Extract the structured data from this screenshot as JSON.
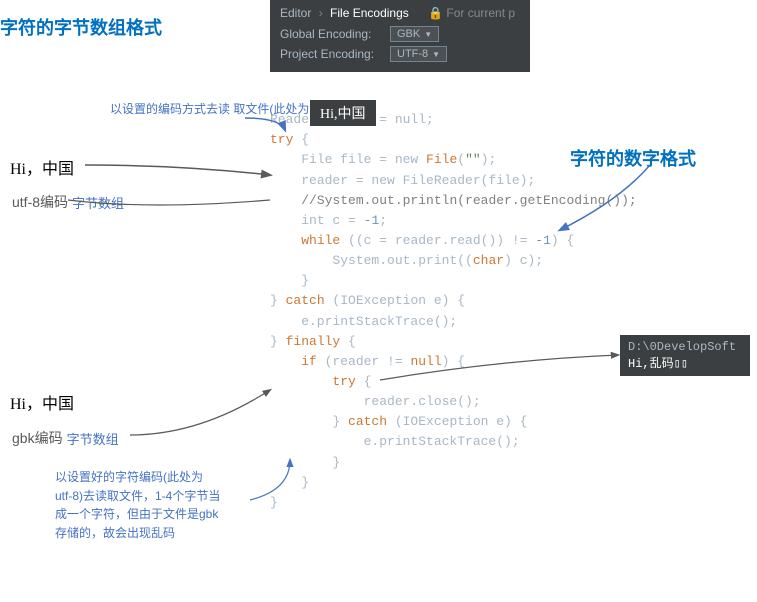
{
  "editor": {
    "breadcrumb_editor": "Editor",
    "breadcrumb_arrow": "›",
    "breadcrumb_section": "File Encodings",
    "breadcrumb_right": "For current p",
    "global_label": "Global Encoding:",
    "global_value": "GBK",
    "project_label": "Project Encoding:",
    "project_value": "UTF-8"
  },
  "left_top": {
    "title": "字符的字节数组格式",
    "annotation": "以设置的编码方式去读\n取文件(此处为utf-8)",
    "hi_label": "Hi，中国",
    "encoding_label": "utf-8编码",
    "byte_array_label": "字节数组"
  },
  "right_top": {
    "title": "字符的数字格式"
  },
  "left_bottom": {
    "hi_label": "Hi，中国",
    "encoding_label": "gbk编码",
    "byte_array_label": "字节数组",
    "annotation": "以设置好的字符编码(此处为\nutf-8)去读取文件，1-4个字节当\n成一个字符，但由于文件是gbk\n存储的，故会出现乱码"
  },
  "hi_popup": {
    "text": "Hi,中国"
  },
  "dev_popup": {
    "path": "D:\\0DevelopSoft",
    "garbled": "Hi,乱码"
  },
  "code": {
    "lines": [
      {
        "type": "normal",
        "text": "Reader reader = null;"
      },
      {
        "type": "keyword_start",
        "text": "try {"
      },
      {
        "type": "indent1",
        "text": "    File file = new File(\"\");"
      },
      {
        "type": "indent1",
        "text": "    reader = new FileReader(file);"
      },
      {
        "type": "indent1_comment",
        "text": "    //System.out.println(reader.getEncoding());"
      },
      {
        "type": "indent1",
        "text": "    int c = -1;"
      },
      {
        "type": "indent1",
        "text": "    while ((c = reader.read()) != -1) {"
      },
      {
        "type": "indent2",
        "text": "        System.out.print((char) c);"
      },
      {
        "type": "indent1",
        "text": "    }"
      },
      {
        "type": "catch",
        "text": "} catch (IOException e) {"
      },
      {
        "type": "indent1",
        "text": "    e.printStackTrace();"
      },
      {
        "type": "finally",
        "text": "} finally {"
      },
      {
        "type": "indent1",
        "text": "    if (reader != null) {"
      },
      {
        "type": "indent2",
        "text": "        try {"
      },
      {
        "type": "indent3",
        "text": "            reader.close();"
      },
      {
        "type": "indent2",
        "text": "        } catch (IOException e) {"
      },
      {
        "type": "indent3",
        "text": "            e.printStackTrace();"
      },
      {
        "type": "indent2",
        "text": "        }"
      },
      {
        "type": "indent1",
        "text": "    }"
      },
      {
        "type": "end",
        "text": "}"
      }
    ]
  }
}
